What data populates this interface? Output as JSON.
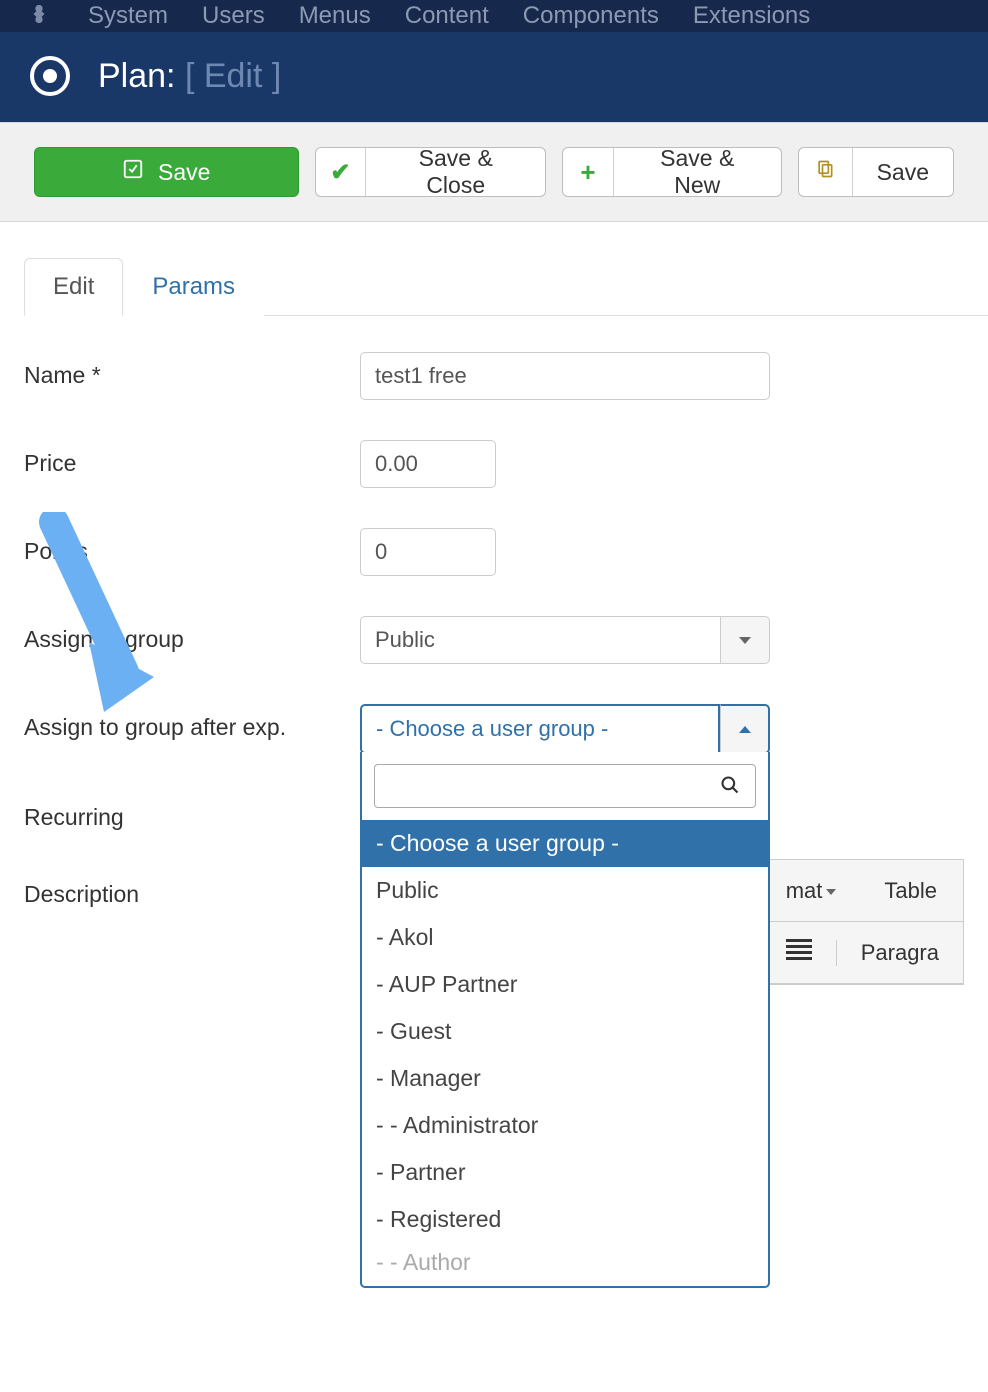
{
  "topnav": {
    "items": [
      "System",
      "Users",
      "Menus",
      "Content",
      "Components",
      "Extensions"
    ]
  },
  "header": {
    "title": "Plan:",
    "subtitle": "[ Edit ]"
  },
  "toolbar": {
    "save": "Save",
    "save_close": "Save & Close",
    "save_new": "Save & New",
    "save_copy": "Save"
  },
  "tabs": {
    "edit": "Edit",
    "params": "Params"
  },
  "form": {
    "name_label": "Name *",
    "name_value": "test1 free",
    "price_label": "Price",
    "price_value": "0.00",
    "points_label": "Points",
    "points_value": "0",
    "assign_group_label": "Assign to group",
    "assign_group_value": "Public",
    "assign_exp_label": "Assign to group after exp.",
    "assign_exp_value": "- Choose a user group -",
    "recurring_label": "Recurring",
    "description_label": "Description"
  },
  "dropdown": {
    "search": "",
    "options": [
      "- Choose a user group -",
      "Public",
      "- Akol",
      "- AUP Partner",
      "- Guest",
      "- Manager",
      "- - Administrator",
      "- Partner",
      "- Registered",
      "- - Author"
    ]
  },
  "editor": {
    "format": "mat",
    "table": "Table",
    "paragraph": "Paragra"
  }
}
